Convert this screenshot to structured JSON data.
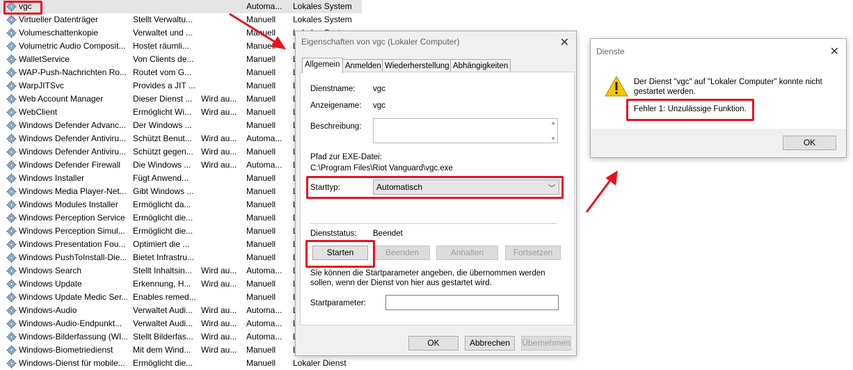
{
  "services": [
    {
      "name": "vgc",
      "desc": "",
      "status": "",
      "start": "Automa...",
      "logon": "Lokales System",
      "selected": true
    },
    {
      "name": "Virtueller Datenträger",
      "desc": "Stellt Verwaltu...",
      "status": "",
      "start": "Manuell",
      "logon": "Lokales System"
    },
    {
      "name": "Volumeschattenkopie",
      "desc": "Verwaltet und ...",
      "status": "",
      "start": "Manuell",
      "logon": "Lokales System"
    },
    {
      "name": "Volumetric Audio Composit...",
      "desc": "Hostet räumli...",
      "status": "",
      "start": "Manuell",
      "logon": "L"
    },
    {
      "name": "WalletService",
      "desc": "Von Clients de...",
      "status": "",
      "start": "Manuell",
      "logon": "L"
    },
    {
      "name": "WAP-Push-Nachrichten Ro...",
      "desc": "Routet vom G...",
      "status": "",
      "start": "Manuell",
      "logon": "L"
    },
    {
      "name": "WarpJITSvc",
      "desc": "Provides a JIT ...",
      "status": "",
      "start": "Manuell",
      "logon": "L"
    },
    {
      "name": "Web Account Manager",
      "desc": "Dieser Dienst ...",
      "status": "Wird au...",
      "start": "Manuell",
      "logon": "L"
    },
    {
      "name": "WebClient",
      "desc": "Ermöglicht Wi...",
      "status": "Wird au...",
      "start": "Manuell",
      "logon": "L"
    },
    {
      "name": "Windows Defender Advanc...",
      "desc": "Der Windows ...",
      "status": "",
      "start": "Manuell",
      "logon": "L"
    },
    {
      "name": "Windows Defender Antiviru...",
      "desc": "Schützt Benut...",
      "status": "Wird au...",
      "start": "Automa...",
      "logon": "L"
    },
    {
      "name": "Windows Defender Antiviru...",
      "desc": "Schützt gegen...",
      "status": "Wird au...",
      "start": "Manuell",
      "logon": "L"
    },
    {
      "name": "Windows Defender Firewall",
      "desc": "Die Windows ...",
      "status": "Wird au...",
      "start": "Automa...",
      "logon": "L"
    },
    {
      "name": "Windows Installer",
      "desc": "Fügt Anwend...",
      "status": "",
      "start": "Manuell",
      "logon": "L"
    },
    {
      "name": "Windows Media Player-Net...",
      "desc": "Gibt Windows ...",
      "status": "",
      "start": "Manuell",
      "logon": "L"
    },
    {
      "name": "Windows Modules Installer",
      "desc": "Ermöglicht da...",
      "status": "",
      "start": "Manuell",
      "logon": "L"
    },
    {
      "name": "Windows Perception Service",
      "desc": "Ermöglicht die...",
      "status": "",
      "start": "Manuell",
      "logon": "L"
    },
    {
      "name": "Windows Perception Simul...",
      "desc": "Ermöglicht die...",
      "status": "",
      "start": "Manuell",
      "logon": "L"
    },
    {
      "name": "Windows Presentation Fou...",
      "desc": "Optimiert die ...",
      "status": "",
      "start": "Manuell",
      "logon": "L"
    },
    {
      "name": "Windows PushToInstall-Die...",
      "desc": "Bietet Infrastru...",
      "status": "",
      "start": "Manuell",
      "logon": "L"
    },
    {
      "name": "Windows Search",
      "desc": "Stellt Inhaltsin...",
      "status": "Wird au...",
      "start": "Automa...",
      "logon": "L"
    },
    {
      "name": "Windows Update",
      "desc": "Erkennung, H...",
      "status": "Wird au...",
      "start": "Manuell",
      "logon": "L"
    },
    {
      "name": "Windows Update Medic Ser...",
      "desc": "Enables remed...",
      "status": "",
      "start": "Manuell",
      "logon": "L"
    },
    {
      "name": "Windows-Audio",
      "desc": "Verwaltet Audi...",
      "status": "Wird au...",
      "start": "Automa...",
      "logon": "L"
    },
    {
      "name": "Windows-Audio-Endpunkt...",
      "desc": "Verwaltet Audi...",
      "status": "Wird au...",
      "start": "Automa...",
      "logon": "L"
    },
    {
      "name": "Windows-Bilderfassung (WI...",
      "desc": "Stellt Bilderfas...",
      "status": "Wird au...",
      "start": "Automa...",
      "logon": "L"
    },
    {
      "name": "Windows-Biometriedienst",
      "desc": "Mit dem Wind...",
      "status": "Wird au...",
      "start": "Manuell",
      "logon": "L"
    },
    {
      "name": "Windows-Dienst für mobile...",
      "desc": "Ermöglicht die...",
      "status": "",
      "start": "Manuell",
      "logon": "Lokaler Dienst"
    }
  ],
  "props": {
    "title": "Eigenschaften von vgc (Lokaler Computer)",
    "tabs": [
      "Allgemein",
      "Anmelden",
      "Wiederherstellung",
      "Abhängigkeiten"
    ],
    "service_name_label": "Dienstname:",
    "service_name": "vgc",
    "display_name_label": "Anzeigename:",
    "display_name": "vgc",
    "description_label": "Beschreibung:",
    "path_label": "Pfad zur EXE-Datei:",
    "path": "C:\\Program Files\\Riot Vanguard\\vgc.exe",
    "starttype_label": "Starttyp:",
    "starttype_value": "Automatisch",
    "status_label": "Dienststatus:",
    "status_value": "Beendet",
    "btn_start": "Starten",
    "btn_stop": "Beenden",
    "btn_pause": "Anhalten",
    "btn_resume": "Fortsetzen",
    "hint": "Sie können die Startparameter angeben, die übernommen werden sollen, wenn der Dienst von hier aus gestartet wird.",
    "params_label": "Startparameter:",
    "ok": "OK",
    "cancel": "Abbrechen",
    "apply": "Übernehmen"
  },
  "error": {
    "title": "Dienste",
    "message": "Der Dienst \"vgc\" auf \"Lokaler Computer\" konnte nicht gestartet werden.",
    "detail": "Fehler 1: Unzulässige Funktion.",
    "ok": "OK"
  },
  "colors": {
    "highlight": "#e8131f",
    "warning": "#f5c400"
  }
}
